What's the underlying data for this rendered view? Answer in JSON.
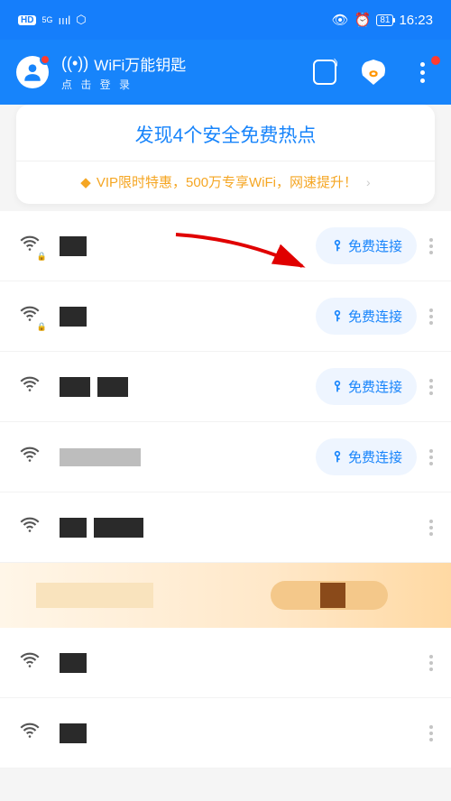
{
  "status": {
    "hd": "HD",
    "network": "5G",
    "time": "16:23",
    "battery": "81"
  },
  "appbar": {
    "title": "WiFi万能钥匙",
    "subtitle": "点 击 登 录"
  },
  "banner": {
    "title": "发现4个安全免费热点",
    "promo": "VIP限时特惠，500万专享WiFi，网速提升！"
  },
  "buttons": {
    "connect": "免费连接"
  },
  "rows": [
    {
      "locked": true,
      "hasConnect": true
    },
    {
      "locked": true,
      "hasConnect": true
    },
    {
      "locked": false,
      "hasConnect": true
    },
    {
      "locked": false,
      "hasConnect": true
    },
    {
      "locked": false,
      "hasConnect": false
    },
    {
      "locked": false,
      "hasConnect": false
    },
    {
      "locked": false,
      "hasConnect": false
    }
  ]
}
